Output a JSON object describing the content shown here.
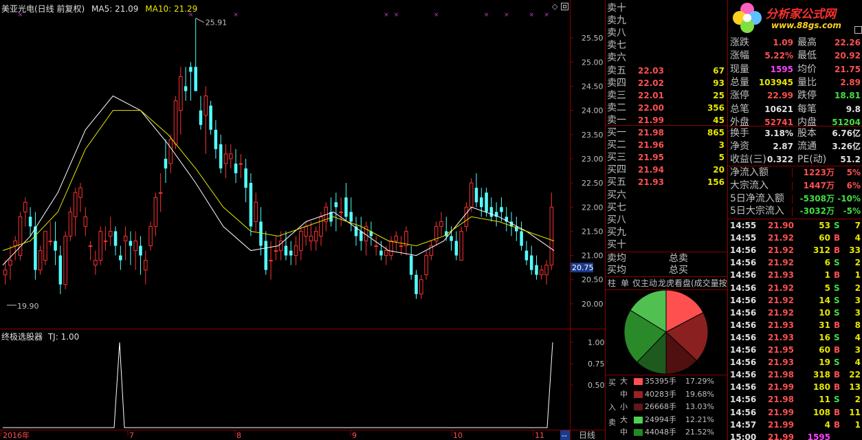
{
  "header": {
    "stock": "美亚光电(日线 前复权)",
    "ma5": "MA5: 21.09",
    "ma10": "MA10: 21.29"
  },
  "indicator": {
    "name": "终极选股器",
    "tj": "TJ: 1.00",
    "ticks": [
      "1.00",
      "0.75",
      "0.50"
    ]
  },
  "price_axis": {
    "ticks": [
      "25.50",
      "25.00",
      "24.50",
      "24.00",
      "23.50",
      "23.00",
      "22.50",
      "22.00",
      "21.50",
      "21.00",
      "20.50",
      "20.00"
    ],
    "current": "20.75",
    "high_mark": "25.91",
    "low_mark": "19.90"
  },
  "time_axis": {
    "labels": [
      "2016年",
      "7",
      "8",
      "9",
      "10",
      "11"
    ],
    "end": "--",
    "period": "日线"
  },
  "icons": {
    "diamond": "◇",
    "window": "restore-window-icon"
  },
  "chart_data": {
    "type": "candlestick",
    "title": "美亚光电(日线 前复权)",
    "ylim": [
      19.6,
      26.0
    ],
    "ma5": 21.09,
    "ma10": 21.29,
    "series": [
      {
        "name": "MA5",
        "values": [
          20.8,
          21.4,
          22.3,
          23.6,
          24.3,
          24.0,
          23.3,
          22.5,
          21.6,
          21.1,
          21.2,
          21.7,
          21.9,
          21.5,
          21.1,
          21.0,
          21.3,
          22.0,
          21.8,
          21.5,
          21.1
        ]
      },
      {
        "name": "MA10",
        "values": [
          21.1,
          21.3,
          21.9,
          23.2,
          24.0,
          24.0,
          23.5,
          22.8,
          22.0,
          21.5,
          21.4,
          21.6,
          21.8,
          21.6,
          21.3,
          21.2,
          21.4,
          21.8,
          21.7,
          21.5,
          21.3
        ]
      }
    ],
    "candles": [
      [
        20.6,
        20.9,
        20.4,
        20.7
      ],
      [
        20.8,
        21.2,
        20.5,
        20.9
      ],
      [
        21.2,
        21.4,
        20.9,
        21.3
      ],
      [
        21.0,
        21.9,
        20.9,
        21.8
      ],
      [
        21.9,
        22.2,
        21.6,
        22.1
      ],
      [
        21.8,
        22.0,
        21.4,
        21.6
      ],
      [
        21.6,
        21.9,
        20.5,
        20.7
      ],
      [
        20.7,
        21.2,
        20.6,
        21.1
      ],
      [
        20.9,
        21.5,
        20.8,
        21.5
      ],
      [
        21.3,
        21.7,
        21.2,
        21.3
      ],
      [
        21.3,
        21.7,
        20.8,
        21.1
      ],
      [
        21.0,
        21.2,
        20.2,
        20.4
      ],
      [
        20.4,
        21.5,
        20.3,
        21.4
      ],
      [
        21.4,
        22.0,
        21.3,
        21.9
      ],
      [
        21.8,
        22.4,
        21.4,
        22.3
      ],
      [
        22.2,
        22.5,
        21.9,
        22.4
      ],
      [
        21.6,
        22.0,
        21.4,
        21.8
      ],
      [
        21.2,
        21.3,
        20.9,
        21.2
      ],
      [
        20.8,
        21.1,
        20.6,
        20.9
      ],
      [
        20.9,
        21.6,
        20.8,
        21.5
      ],
      [
        21.3,
        21.6,
        21.1,
        21.3
      ],
      [
        21.4,
        21.8,
        21.2,
        21.5
      ],
      [
        21.5,
        21.6,
        21.0,
        21.2
      ],
      [
        21.0,
        21.2,
        20.7,
        20.9
      ],
      [
        21.3,
        21.6,
        20.9,
        21.4
      ],
      [
        21.3,
        21.5,
        20.8,
        21.2
      ],
      [
        21.1,
        21.5,
        20.7,
        21.3
      ],
      [
        21.2,
        21.4,
        20.6,
        21.0
      ],
      [
        20.7,
        21.1,
        20.4,
        20.9
      ],
      [
        21.2,
        21.7,
        21.1,
        21.6
      ],
      [
        21.6,
        22.3,
        21.4,
        22.2
      ],
      [
        22.3,
        22.7,
        21.9,
        22.3
      ],
      [
        23.0,
        23.4,
        22.5,
        22.8
      ],
      [
        22.9,
        23.5,
        22.7,
        23.4
      ],
      [
        23.3,
        24.3,
        23.2,
        24.2
      ],
      [
        24.0,
        24.9,
        23.5,
        24.7
      ],
      [
        24.5,
        24.9,
        24.2,
        24.4
      ],
      [
        24.9,
        25.0,
        24.2,
        24.8
      ],
      [
        24.9,
        25.9,
        24.4,
        24.4
      ],
      [
        24.0,
        24.3,
        23.6,
        23.7
      ],
      [
        23.9,
        24.5,
        23.1,
        24.3
      ],
      [
        24.1,
        24.2,
        23.5,
        23.6
      ],
      [
        23.6,
        23.8,
        23.0,
        23.2
      ],
      [
        23.3,
        23.5,
        22.7,
        22.8
      ],
      [
        22.9,
        23.3,
        22.6,
        23.1
      ],
      [
        23.0,
        23.3,
        22.8,
        23.1
      ],
      [
        22.9,
        23.2,
        22.5,
        22.7
      ],
      [
        22.9,
        23.1,
        22.6,
        22.9
      ],
      [
        22.8,
        23.0,
        22.1,
        22.4
      ],
      [
        22.5,
        22.7,
        21.4,
        21.6
      ],
      [
        21.7,
        22.3,
        21.5,
        22.1
      ],
      [
        21.7,
        22.0,
        21.0,
        21.2
      ],
      [
        21.3,
        21.5,
        20.6,
        20.7
      ],
      [
        20.9,
        21.3,
        20.5,
        20.9
      ],
      [
        21.1,
        21.4,
        20.9,
        21.1
      ],
      [
        21.1,
        21.5,
        20.9,
        21.3
      ],
      [
        21.2,
        21.5,
        20.9,
        21.0
      ],
      [
        21.1,
        21.3,
        20.8,
        21.0
      ],
      [
        21.0,
        21.4,
        20.8,
        21.2
      ],
      [
        21.1,
        21.6,
        20.9,
        21.5
      ],
      [
        21.4,
        21.7,
        21.2,
        21.6
      ],
      [
        21.3,
        21.7,
        21.1,
        21.4
      ],
      [
        21.3,
        21.6,
        21.1,
        21.5
      ],
      [
        21.4,
        21.9,
        21.2,
        21.8
      ],
      [
        21.7,
        22.1,
        21.5,
        22.0
      ],
      [
        21.9,
        22.2,
        21.6,
        21.7
      ],
      [
        22.1,
        22.3,
        21.5,
        22.0
      ],
      [
        21.9,
        22.2,
        21.6,
        21.9
      ],
      [
        22.2,
        22.5,
        21.7,
        21.8
      ],
      [
        21.9,
        22.2,
        21.5,
        21.7
      ],
      [
        21.6,
        21.8,
        21.2,
        21.4
      ],
      [
        21.5,
        21.8,
        21.1,
        21.3
      ],
      [
        21.3,
        21.7,
        21.0,
        21.6
      ],
      [
        21.5,
        21.7,
        21.2,
        21.4
      ],
      [
        21.2,
        21.4,
        21.0,
        21.2
      ],
      [
        21.1,
        21.3,
        20.9,
        21.0
      ],
      [
        21.0,
        21.2,
        20.8,
        21.1
      ],
      [
        21.0,
        21.4,
        20.9,
        21.3
      ],
      [
        21.3,
        21.5,
        21.1,
        21.4
      ],
      [
        21.2,
        21.4,
        21.0,
        21.2
      ],
      [
        21.2,
        21.6,
        21.0,
        21.5
      ],
      [
        21.0,
        21.2,
        20.5,
        20.6
      ],
      [
        20.6,
        20.7,
        20.1,
        20.2
      ],
      [
        20.2,
        20.6,
        20.1,
        20.5
      ],
      [
        20.6,
        21.1,
        20.5,
        21.0
      ],
      [
        21.0,
        21.3,
        20.9,
        21.2
      ],
      [
        21.3,
        21.7,
        21.2,
        21.6
      ],
      [
        21.6,
        21.9,
        21.4,
        21.7
      ],
      [
        21.5,
        21.8,
        21.3,
        21.4
      ],
      [
        21.4,
        21.6,
        21.1,
        21.3
      ],
      [
        21.3,
        21.5,
        20.9,
        21.0
      ],
      [
        20.9,
        21.6,
        20.9,
        21.5
      ],
      [
        21.6,
        22.1,
        21.5,
        22.0
      ],
      [
        22.0,
        22.6,
        21.9,
        22.5
      ],
      [
        22.4,
        22.7,
        22.0,
        22.1
      ],
      [
        22.2,
        22.4,
        21.8,
        22.0
      ],
      [
        22.3,
        22.4,
        21.8,
        21.9
      ],
      [
        22.0,
        22.2,
        21.7,
        21.8
      ],
      [
        21.9,
        22.1,
        21.6,
        21.8
      ],
      [
        22.0,
        22.2,
        21.7,
        21.9
      ],
      [
        21.8,
        22.0,
        21.5,
        21.7
      ],
      [
        21.7,
        21.9,
        21.4,
        21.6
      ],
      [
        21.6,
        21.8,
        21.3,
        21.5
      ],
      [
        21.5,
        21.7,
        21.1,
        21.2
      ],
      [
        21.1,
        21.3,
        20.8,
        20.9
      ],
      [
        21.0,
        21.2,
        20.6,
        20.7
      ],
      [
        20.8,
        21.0,
        20.5,
        20.6
      ],
      [
        20.6,
        20.8,
        20.5,
        20.7
      ],
      [
        20.6,
        20.9,
        20.4,
        20.8
      ],
      [
        20.8,
        22.3,
        20.7,
        22.0
      ]
    ]
  },
  "orderbook": {
    "asks": [
      {
        "label": "卖十",
        "price": "",
        "vol": ""
      },
      {
        "label": "卖九",
        "price": "",
        "vol": ""
      },
      {
        "label": "卖八",
        "price": "",
        "vol": ""
      },
      {
        "label": "卖七",
        "price": "",
        "vol": ""
      },
      {
        "label": "卖六",
        "price": "",
        "vol": ""
      },
      {
        "label": "卖五",
        "price": "22.03",
        "vol": "67"
      },
      {
        "label": "卖四",
        "price": "22.02",
        "vol": "93"
      },
      {
        "label": "卖三",
        "price": "22.01",
        "vol": "25"
      },
      {
        "label": "卖二",
        "price": "22.00",
        "vol": "356"
      },
      {
        "label": "卖一",
        "price": "21.99",
        "vol": "45"
      }
    ],
    "bids": [
      {
        "label": "买一",
        "price": "21.98",
        "vol": "865"
      },
      {
        "label": "买二",
        "price": "21.96",
        "vol": "3"
      },
      {
        "label": "买三",
        "price": "21.95",
        "vol": "5"
      },
      {
        "label": "买四",
        "price": "21.94",
        "vol": "20"
      },
      {
        "label": "买五",
        "price": "21.93",
        "vol": "156"
      },
      {
        "label": "买六",
        "price": "",
        "vol": ""
      },
      {
        "label": "买七",
        "price": "",
        "vol": ""
      },
      {
        "label": "买八",
        "price": "",
        "vol": ""
      },
      {
        "label": "买九",
        "price": "",
        "vol": ""
      },
      {
        "label": "买十",
        "price": "",
        "vol": ""
      }
    ],
    "avg": [
      {
        "l": "卖均",
        "r": "总卖"
      },
      {
        "l": "买均",
        "r": "总买"
      }
    ]
  },
  "tabs": [
    "柱",
    "单",
    "仅主动",
    "龙虎看盘(成交量按"
  ],
  "pie": {
    "slices": [
      17.29,
      19.68,
      13.03,
      12.21,
      21.52,
      16.27
    ]
  },
  "flow": {
    "buy_label": [
      "买",
      "入"
    ],
    "sell_label": "卖",
    "rows": [
      {
        "size": "大",
        "vol": "35395手",
        "pct": "17.29%",
        "color": "#ff5050"
      },
      {
        "size": "中",
        "vol": "40283手",
        "pct": "19.68%",
        "color": "#a02020"
      },
      {
        "size": "小",
        "vol": "26668手",
        "pct": "13.03%",
        "color": "#601818"
      },
      {
        "size": "大",
        "vol": "24994手",
        "pct": "12.21%",
        "color": "#50d050"
      },
      {
        "size": "中",
        "vol": "44048手",
        "pct": "21.52%",
        "color": "#208a20"
      }
    ]
  },
  "logo": {
    "brand": "分析家公式网",
    "url": "www.88gs.com"
  },
  "stats": [
    {
      "a": "涨跌",
      "b": "1.09",
      "c": "最高",
      "d": "22.26",
      "bc": "#ff5050",
      "dc": "#ff5050"
    },
    {
      "a": "涨幅",
      "b": "5.22%",
      "c": "最低",
      "d": "20.92",
      "bc": "#ff5050",
      "dc": "#ff5050"
    },
    {
      "a": "现量",
      "b": "1595",
      "c": "均价",
      "d": "21.75",
      "bc": "#ff40ff",
      "dc": "#ff5050"
    },
    {
      "a": "总量",
      "b": "103945",
      "c": "量比",
      "d": "2.89",
      "bc": "#e8e800",
      "dc": "#ff5050"
    },
    {
      "a": "涨停",
      "b": "22.99",
      "c": "跌停",
      "d": "18.81",
      "bc": "#ff5050",
      "dc": "#40e040"
    },
    {
      "a": "总笔",
      "b": "10621",
      "c": "每笔",
      "d": "9.8",
      "bc": "#e0e0e0",
      "dc": "#e0e0e0"
    },
    {
      "a": "外盘",
      "b": "52741",
      "c": "内盘",
      "d": "51204",
      "bc": "#ff5050",
      "dc": "#40e040"
    },
    {
      "a": "换手",
      "b": "3.18%",
      "c": "股本",
      "d": "6.76亿",
      "bc": "#e0e0e0",
      "dc": "#e0e0e0"
    },
    {
      "a": "净资",
      "b": "2.87",
      "c": "流通",
      "d": "3.26亿",
      "bc": "#e0e0e0",
      "dc": "#e0e0e0"
    },
    {
      "a": "收益(三)",
      "b": "0.322",
      "c": "PE(动)",
      "d": "51.2",
      "bc": "#e0e0e0",
      "dc": "#e0e0e0"
    }
  ],
  "fund_flow": [
    {
      "label": "净流入额",
      "value": "1223万",
      "pct": "5%",
      "color": "#ff5050"
    },
    {
      "label": "大宗流入",
      "value": "1447万",
      "pct": "6%",
      "color": "#ff5050"
    },
    {
      "label": "5日净流入额",
      "value": "-5308万",
      "pct": "-10%",
      "color": "#40e040"
    },
    {
      "label": "5日大宗流入",
      "value": "-3032万",
      "pct": "-5%",
      "color": "#40e040"
    }
  ],
  "trades": [
    {
      "t": "14:55",
      "p": "21.90",
      "v": "53",
      "s": "S",
      "x": "7"
    },
    {
      "t": "14:55",
      "p": "21.92",
      "v": "60",
      "s": "B",
      "x": "4"
    },
    {
      "t": "14:56",
      "p": "21.92",
      "v": "312",
      "s": "B",
      "x": "33"
    },
    {
      "t": "14:56",
      "p": "21.92",
      "v": "6",
      "s": "S",
      "x": "2"
    },
    {
      "t": "14:56",
      "p": "21.93",
      "v": "1",
      "s": "B",
      "x": "1"
    },
    {
      "t": "14:56",
      "p": "21.92",
      "v": "5",
      "s": "S",
      "x": "2"
    },
    {
      "t": "14:56",
      "p": "21.92",
      "v": "14",
      "s": "S",
      "x": "3"
    },
    {
      "t": "14:56",
      "p": "21.92",
      "v": "10",
      "s": "S",
      "x": "3"
    },
    {
      "t": "14:56",
      "p": "21.93",
      "v": "31",
      "s": "B",
      "x": "8"
    },
    {
      "t": "14:56",
      "p": "21.93",
      "v": "16",
      "s": "S",
      "x": "4"
    },
    {
      "t": "14:56",
      "p": "21.95",
      "v": "60",
      "s": "B",
      "x": "3"
    },
    {
      "t": "14:56",
      "p": "21.93",
      "v": "19",
      "s": "S",
      "x": "4"
    },
    {
      "t": "14:56",
      "p": "21.98",
      "v": "318",
      "s": "B",
      "x": "22"
    },
    {
      "t": "14:56",
      "p": "21.99",
      "v": "180",
      "s": "B",
      "x": "13"
    },
    {
      "t": "14:56",
      "p": "21.98",
      "v": "11",
      "s": "S",
      "x": "2"
    },
    {
      "t": "14:56",
      "p": "21.99",
      "v": "108",
      "s": "B",
      "x": "11"
    },
    {
      "t": "14:57",
      "p": "21.99",
      "v": "4",
      "s": "B",
      "x": "1"
    },
    {
      "t": "15:00",
      "p": "21.99",
      "v": "1595",
      "s": "",
      "x": ""
    }
  ]
}
